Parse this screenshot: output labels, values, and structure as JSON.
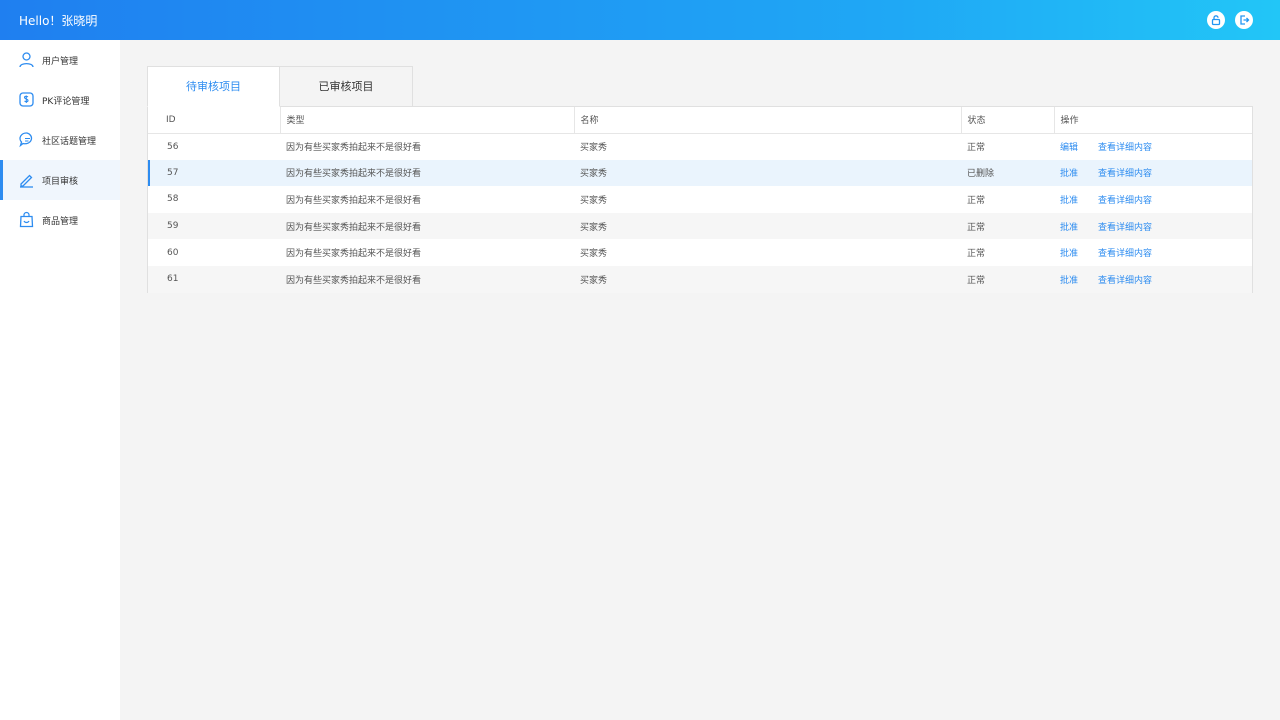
{
  "header": {
    "greeting": "Hello！张晓明",
    "icons": [
      "lock-icon",
      "logout-icon"
    ]
  },
  "sidebar": {
    "items": [
      {
        "label": "用户管理",
        "icon": "user-icon"
      },
      {
        "label": "PK评论管理",
        "icon": "dollar-chat-icon"
      },
      {
        "label": "社区话题管理",
        "icon": "chat-bubbles-icon"
      },
      {
        "label": "项目审核",
        "icon": "edit-pen-icon",
        "active": true
      },
      {
        "label": "商品管理",
        "icon": "shopping-bag-icon"
      }
    ]
  },
  "tabs": {
    "pending": "待审核项目",
    "reviewed": "已审核项目"
  },
  "table": {
    "headers": [
      "ID",
      "类型",
      "名称",
      "状态",
      "操作"
    ],
    "rows": [
      {
        "id": "56",
        "type": "因为有些买家秀拍起来不是很好看",
        "name": "买家秀",
        "status": "正常",
        "action1": "编辑",
        "action2": "查看详细内容"
      },
      {
        "id": "57",
        "type": "因为有些买家秀拍起来不是很好看",
        "name": "买家秀",
        "status": "已删除",
        "action1": "批准",
        "action2": "查看详细内容"
      },
      {
        "id": "58",
        "type": "因为有些买家秀拍起来不是很好看",
        "name": "买家秀",
        "status": "正常",
        "action1": "批准",
        "action2": "查看详细内容"
      },
      {
        "id": "59",
        "type": "因为有些买家秀拍起来不是很好看",
        "name": "买家秀",
        "status": "正常",
        "action1": "批准",
        "action2": "查看详细内容"
      },
      {
        "id": "60",
        "type": "因为有些买家秀拍起来不是很好看",
        "name": "买家秀",
        "status": "正常",
        "action1": "批准",
        "action2": "查看详细内容"
      },
      {
        "id": "61",
        "type": "因为有些买家秀拍起来不是很好看",
        "name": "买家秀",
        "status": "正常",
        "action1": "批准",
        "action2": "查看详细内容"
      }
    ]
  },
  "colors": {
    "accent": "#2d8cf0",
    "header_gradient_start": "#1f7ff0",
    "header_gradient_end": "#22c6f7"
  }
}
